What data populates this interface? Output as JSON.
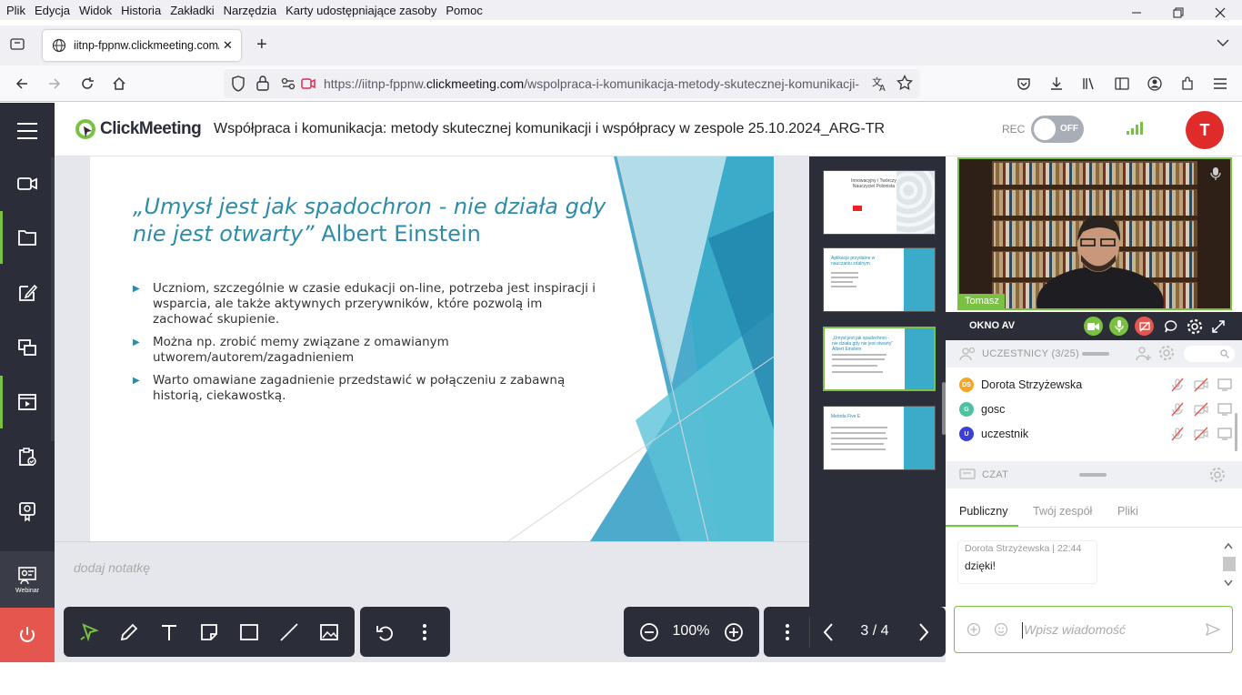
{
  "menubar": {
    "items": [
      "Plik",
      "Edycja",
      "Widok",
      "Historia",
      "Zakładki",
      "Narzędzia",
      "Karty udostępniające zasoby",
      "Pomoc"
    ]
  },
  "browser": {
    "tab_title": "iitnp-fppnw.clickmeeting.com/",
    "url_prefix": "https://iitnp-fppnw.",
    "url_domain": "clickmeeting.com",
    "url_path": "/wspolpraca-i-komunikacja-metody-skutecznej-komunikacji-"
  },
  "header": {
    "logo": "ClickMeeting",
    "title": "Współpraca i komunikacja: metody skutecznej komunikacji i współpracy w zespole 25.10.2024_ARG-TR",
    "rec_label": "REC",
    "rec_state": "OFF",
    "user_initial": "T"
  },
  "sidebar": {
    "webinar_label": "Webinar"
  },
  "slide": {
    "quote_italic": "„Umysł jest jak spadochron - nie działa gdy nie jest otwarty”",
    "quote_author": " Albert Einstein",
    "bullets": [
      "Uczniom, szczególnie w czasie edukacji on-line, potrzeba jest inspiracji i wsparcia, ale także aktywnych przerywników, które pozwolą im zachować skupienie.",
      "Można np. zrobić memy związane z omawianym utworem/autorem/zagadnieniem",
      "Warto omawiane zagadnienie przedstawić w połączeniu z zabawną historią, ciekawostką."
    ]
  },
  "thumbnails": [
    {
      "title": "Innowacyjny i Twórczy Nauczyciel Polonista"
    },
    {
      "title": "Aplikacje przydatne w nauczaniu zdalnym"
    },
    {
      "title": "„Umysł jest jak spadochron - nie działa gdy nie jest otwarty” Albert Einstein"
    },
    {
      "title": "Metoda Five E"
    }
  ],
  "notes": {
    "placeholder": "dodaj notatkę"
  },
  "toolbar": {
    "zoom": "100%",
    "page": "3 / 4"
  },
  "video": {
    "name": "Tomasz"
  },
  "av_panel": {
    "label": "OKNO AV"
  },
  "participants": {
    "label": "UCZESTNICY (3/25)",
    "list": [
      {
        "initials": "DS",
        "name": "Dorota Strzyżewska",
        "color": "#f5a623"
      },
      {
        "initials": "G",
        "name": "gosc",
        "color": "#4ec1a1"
      },
      {
        "initials": "U",
        "name": "uczestnik",
        "color": "#3b3fd8"
      }
    ]
  },
  "chat": {
    "label": "CZAT",
    "tabs": [
      "Publiczny",
      "Twój zespół",
      "Pliki"
    ],
    "messages": [
      {
        "author": "Dorota Strzyżewska",
        "time": "22:44",
        "text": "dzięki!"
      }
    ],
    "placeholder": "Wpisz wiadomość"
  },
  "colors": {
    "accent": "#7ac143",
    "dark": "#2b2e38",
    "slide_blue": "#2d8ca8",
    "power_red": "#e4564e"
  }
}
